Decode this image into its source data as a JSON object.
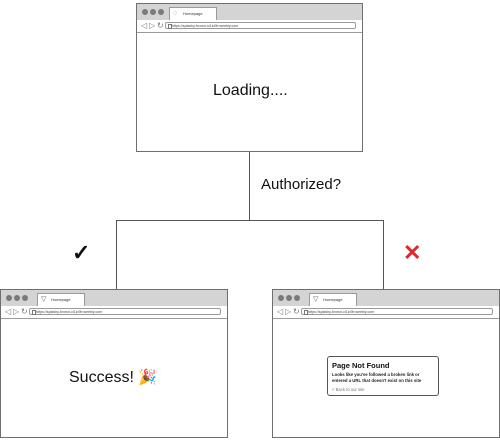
{
  "top_window": {
    "tab_label": "Homepage",
    "url": "https://splashy-brown-ci1lo9b.weebly.com",
    "content": "Loading...."
  },
  "decision": {
    "label": "Authorized?",
    "yes_mark": "✓",
    "no_mark": "✕",
    "yes_color": "#111111",
    "no_color": "#e0262b"
  },
  "left_window": {
    "tab_label": "Homepage",
    "url": "https://splashy-brown-ci1lo9b.weebly.com",
    "content": "Success!",
    "emoji": "🎉"
  },
  "right_window": {
    "tab_label": "Homepage",
    "url": "https://splashy-brown-ci1lo9b.weebly.com",
    "card_title": "Page Not Found",
    "card_body": "Looks like you've followed a broken link or entered a URL that doesn't exist on this site",
    "card_link": "< Back to our site"
  }
}
